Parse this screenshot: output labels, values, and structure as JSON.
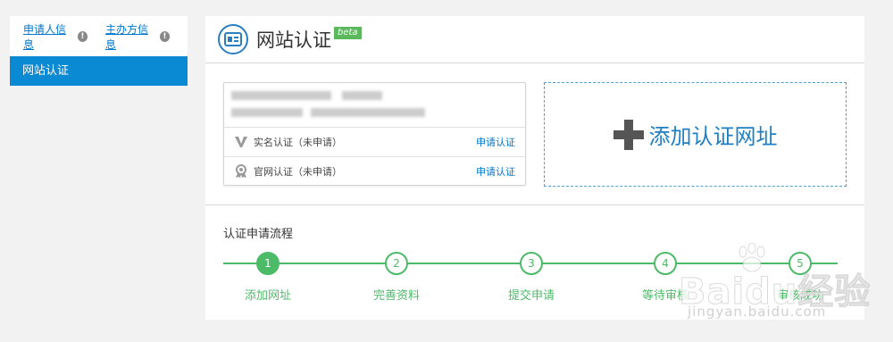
{
  "sidebar": {
    "links": [
      {
        "label": "申请人信息"
      },
      {
        "label": "主办方信息"
      }
    ],
    "active_item": "网站认证"
  },
  "header": {
    "title": "网站认证",
    "badge": "beta"
  },
  "site_card": {
    "rows": [
      {
        "label": "实名认证（未申请）",
        "action": "申请认证",
        "icon": "v-verified-icon"
      },
      {
        "label": "官网认证（未申请）",
        "action": "申请认证",
        "icon": "award-ribbon-icon"
      }
    ]
  },
  "add_certification": {
    "label": "添加认证网址"
  },
  "process": {
    "title": "认证申请流程",
    "steps": [
      {
        "number": "1",
        "label": "添加网址",
        "active": true
      },
      {
        "number": "2",
        "label": "完善资料",
        "active": false
      },
      {
        "number": "3",
        "label": "提交申请",
        "active": false
      },
      {
        "number": "4",
        "label": "等待审核",
        "active": false
      },
      {
        "number": "5",
        "label": "审核成功",
        "active": false
      }
    ]
  },
  "watermark": {
    "brand": "Baidu经验",
    "url": "jingyan.baidu.com"
  },
  "colors": {
    "accent_blue": "#0a8ad2",
    "link_blue": "#0077cc",
    "success_green": "#4cbb68",
    "badge_green": "#5cb85c"
  }
}
